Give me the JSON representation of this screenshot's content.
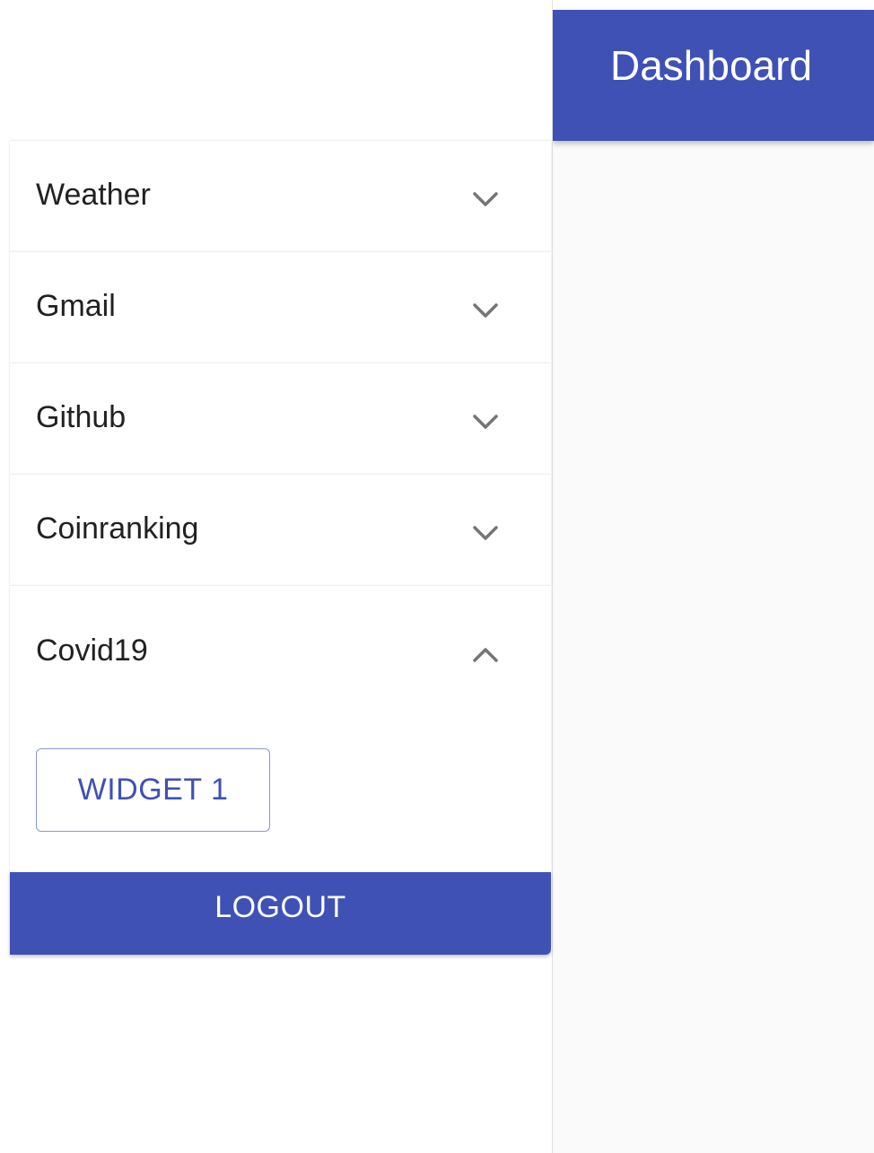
{
  "appbar": {
    "title": "Dashboard"
  },
  "drawer": {
    "items": [
      {
        "label": "Weather",
        "expanded": false,
        "icon": "chevron-down-icon"
      },
      {
        "label": "Gmail",
        "expanded": false,
        "icon": "chevron-down-icon"
      },
      {
        "label": "Github",
        "expanded": false,
        "icon": "chevron-down-icon"
      },
      {
        "label": "Coinranking",
        "expanded": false,
        "icon": "chevron-down-icon"
      },
      {
        "label": "Covid19",
        "expanded": true,
        "icon": "chevron-up-icon",
        "widgets": [
          {
            "label": "WIDGET 1"
          }
        ]
      }
    ],
    "logout_label": "LOGOUT"
  },
  "colors": {
    "primary": "#3f51b5",
    "main_background": "#fafafa",
    "drawer_background": "#ffffff",
    "text": "#212121"
  }
}
